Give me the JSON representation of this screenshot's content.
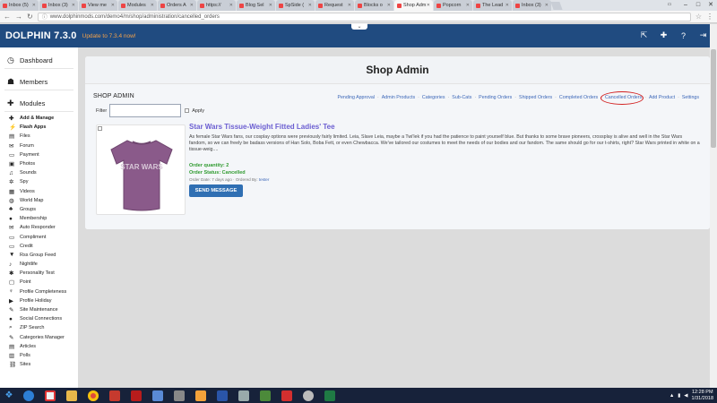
{
  "browser": {
    "tabs": [
      {
        "label": "Inbox (5)",
        "active": false
      },
      {
        "label": "Inbox (3)",
        "active": false
      },
      {
        "label": "View me",
        "active": false
      },
      {
        "label": "Modules",
        "active": false
      },
      {
        "label": "Orders A",
        "active": false
      },
      {
        "label": "https://",
        "active": false
      },
      {
        "label": "Blog Sel",
        "active": false
      },
      {
        "label": "SpSide (",
        "active": false
      },
      {
        "label": "Request",
        "active": false
      },
      {
        "label": "Blocks o",
        "active": false
      },
      {
        "label": "Shop Adm",
        "active": true
      },
      {
        "label": "Popcorn",
        "active": false
      },
      {
        "label": "The Lead",
        "active": false
      },
      {
        "label": "Inbox (3)",
        "active": false
      }
    ],
    "url": "www.dolphinmods.com/demo4/m/shop/administration/cancelled_orders"
  },
  "header": {
    "brand": "DOLPHIN 7.3.0",
    "update_notice": "Update to 7.3.4 now!"
  },
  "sidebar": {
    "dashboard": "Dashboard",
    "members": "Members",
    "modules": "Modules",
    "items": [
      {
        "label": "Add & Manage",
        "icon": "plus-icon",
        "glyph": "✚",
        "bold": true
      },
      {
        "label": "Flash Apps",
        "icon": "bolt-icon",
        "glyph": "⚡",
        "bold": true
      },
      {
        "label": "Files",
        "icon": "file-icon",
        "glyph": "▤"
      },
      {
        "label": "Forum",
        "icon": "forum-icon",
        "glyph": "✉"
      },
      {
        "label": "Payment",
        "icon": "payment-icon",
        "glyph": "▭"
      },
      {
        "label": "Photos",
        "icon": "photo-icon",
        "glyph": "▣"
      },
      {
        "label": "Sounds",
        "icon": "sound-icon",
        "glyph": "♫"
      },
      {
        "label": "Spy",
        "icon": "spy-icon",
        "glyph": "✲"
      },
      {
        "label": "Videos",
        "icon": "video-icon",
        "glyph": "▦"
      },
      {
        "label": "World Map",
        "icon": "globe-icon",
        "glyph": "◍"
      },
      {
        "label": "Groups",
        "icon": "groups-icon",
        "glyph": "♣"
      },
      {
        "label": "Membership",
        "icon": "membership-icon",
        "glyph": "●"
      },
      {
        "label": "Auto Responder",
        "icon": "mail-icon",
        "glyph": "✉"
      },
      {
        "label": "Compliment",
        "icon": "compliment-icon",
        "glyph": "▭"
      },
      {
        "label": "Credit",
        "icon": "credit-icon",
        "glyph": "▭"
      },
      {
        "label": "Rss Group Feed",
        "icon": "filter-icon",
        "glyph": "▼"
      },
      {
        "label": "Nightlife",
        "icon": "nightlife-icon",
        "glyph": "♪"
      },
      {
        "label": "Personality Test",
        "icon": "personality-icon",
        "glyph": "✱"
      },
      {
        "label": "Point",
        "icon": "point-icon",
        "glyph": "▢"
      },
      {
        "label": "Profile Completeness",
        "icon": "trophy-icon",
        "glyph": "♆"
      },
      {
        "label": "Profile Holiday",
        "icon": "holiday-icon",
        "glyph": "▶"
      },
      {
        "label": "Site Maintenance",
        "icon": "wrench-icon",
        "glyph": "✎"
      },
      {
        "label": "Social Connections",
        "icon": "social-icon",
        "glyph": "●"
      },
      {
        "label": "ZIP Search",
        "icon": "search-icon",
        "glyph": "⌕"
      },
      {
        "label": "Categories Manager",
        "icon": "categories-icon",
        "glyph": "✎"
      },
      {
        "label": "Articles",
        "icon": "articles-icon",
        "glyph": "▤"
      },
      {
        "label": "Polls",
        "icon": "polls-icon",
        "glyph": "▥"
      },
      {
        "label": "Sites",
        "icon": "sites-icon",
        "glyph": "⛓"
      }
    ]
  },
  "main": {
    "title": "Shop Admin",
    "subtitle": "SHOP ADMIN",
    "nav": [
      {
        "label": "Pending Approval",
        "current": false
      },
      {
        "label": "Admin Products",
        "current": false
      },
      {
        "label": "Categories",
        "current": false
      },
      {
        "label": "Sub-Cats",
        "current": false
      },
      {
        "label": "Pending Orders",
        "current": false
      },
      {
        "label": "Shipped Orders",
        "current": false
      },
      {
        "label": "Completed Orders",
        "current": false
      },
      {
        "label": "Cancelled Orders",
        "current": true
      },
      {
        "label": "Add Product",
        "current": false
      },
      {
        "label": "Settings",
        "current": false
      }
    ],
    "filter_label": "Filter",
    "filter_value": "",
    "apply_label": "Apply",
    "item": {
      "title": "Star Wars Tissue-Weight Fitted Ladies' Tee",
      "description": "As female Star Wars fans, our cosplay options were previously fairly limited. Leia, Slave Leia, maybe a Twi'lek if you had the patience to paint yourself blue. But thanks to some brave pioneers, crossplay is alive and well in the Star Wars fandom, so we can freely be badass versions of Han Solo, Boba Fett, or even Chewbacca. We've tailored our costumes to meet the needs of our bodies and our fandom. The same should go for our t-shirts, right? Star Wars printed in white on a tissue-weig....",
      "quantity": "Order quantity: 2",
      "status": "Order Status: Cancelled",
      "meta_prefix": "Order Date: 7 days ago · Ordered By:",
      "ordered_by": "tester",
      "shirt_print": "STAR WARS",
      "send_label": "SEND MESSAGE"
    }
  },
  "taskbar": {
    "time": "12:28 PM",
    "date": "1/31/2018"
  },
  "colors": {
    "header_bg": "#204b80",
    "link": "#3c67b8",
    "title_purple": "#6b5ed1",
    "status_green": "#2f9a2f",
    "button_blue": "#2f6fb3",
    "highlight_red": "#d21f1f"
  }
}
